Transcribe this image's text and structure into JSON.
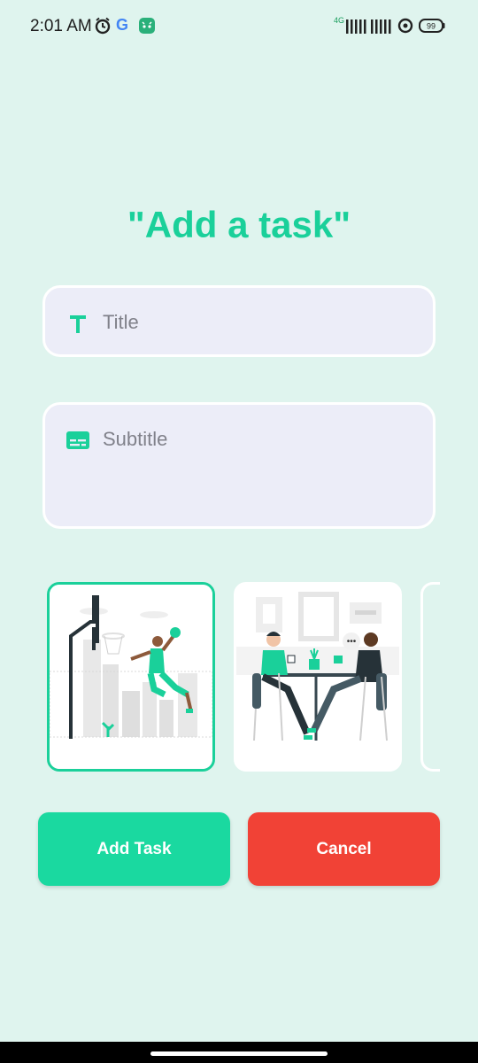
{
  "status_bar": {
    "time": "2:01 AM",
    "google_label": "G",
    "network_label": "4G",
    "battery_level": "99"
  },
  "page": {
    "title": "\"Add a task\""
  },
  "form": {
    "title_placeholder": "Title",
    "subtitle_placeholder": "Subtitle"
  },
  "image_picker": {
    "selected_index": 0,
    "items": [
      "basketball-illustration",
      "coffee-meeting-illustration",
      "partial-illustration"
    ]
  },
  "actions": {
    "add_label": "Add Task",
    "cancel_label": "Cancel"
  },
  "colors": {
    "background": "#dff4ee",
    "accent": "#1ad09a",
    "add_button": "#1ad9a0",
    "cancel_button": "#f14236",
    "field_bg": "#ecedf8"
  }
}
